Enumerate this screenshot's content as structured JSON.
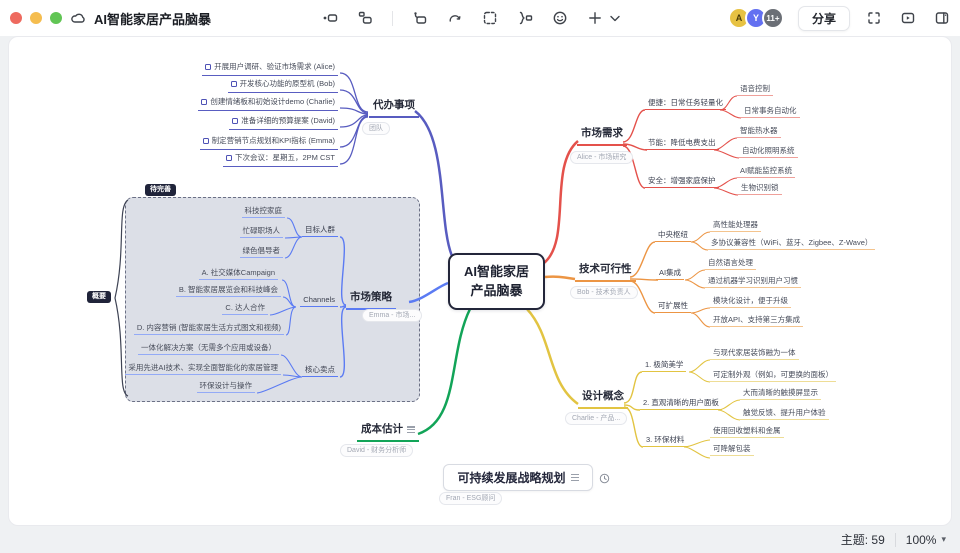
{
  "window": {
    "title": "AI智能家居产品脑暴",
    "toolbar": {
      "share_label": "分享",
      "avatars": [
        "A",
        "Y",
        "11+"
      ],
      "icon_names": [
        "cloud-icon",
        "topic-icon",
        "subtopic-icon",
        "relation-icon",
        "redo-icon",
        "marquee-select-icon",
        "summary-icon",
        "emoji-icon",
        "insert-icon",
        "chevron-down-icon",
        "fullscreen-icon",
        "present-icon",
        "side-panel-icon"
      ]
    }
  },
  "statusbar": {
    "topics": "主题: 59",
    "zoom": "100%"
  },
  "colors": {
    "todo": "#585cc0",
    "strategy": "#5b7bf3",
    "cost": "#12a458",
    "demand": "#e4514b",
    "tech": "#ec9544",
    "design": "#e2c442",
    "central_border": "#23263a"
  },
  "map": {
    "central": {
      "line1": "AI智能家居",
      "line2": "产品脑暴"
    },
    "todo": {
      "label": "代办事项",
      "tag": "团队",
      "items": [
        "开展用户调研、验证市场需求 (Alice)",
        "开发核心功能的原型机 (Bob)",
        "创建情绪板和初始设计demo (Charlie)",
        "准备详细的预算提案 (David)",
        "制定营销节点规划和KPI指标 (Emma)",
        "下次会议：星期五，2PM CST"
      ]
    },
    "strategy": {
      "label": "市场策略",
      "tag": "Emma - 市场...",
      "group_badge": "待完善",
      "summary_badge": "概要",
      "audience": {
        "label": "目标人群",
        "leaves": [
          "科技控家庭",
          "忙碌职场人",
          "绿色倡导者"
        ]
      },
      "channels": {
        "label": "Channels",
        "leaves": [
          "A. 社交媒体Campaign",
          "B. 智能家居展览会和科技峰会",
          "C. 达人合作",
          "D. 内容营销 (智能家居生活方式图文和视频)"
        ]
      },
      "selling": {
        "label": "核心卖点",
        "leaves": [
          "一体化解决方案（无需多个应用或设备）",
          "采用先进AI技术、实现全面智能化的家居管理",
          "环保设计与操作"
        ]
      }
    },
    "cost": {
      "label": "成本估计",
      "tag": "David - 财务分析师"
    },
    "demand": {
      "label": "市场需求",
      "tag": "Alice - 市场研究",
      "children": [
        {
          "label": "便捷：日常任务轻量化",
          "leaves": [
            "语音控制",
            "日常事务自动化"
          ]
        },
        {
          "label": "节能：降低电费支出",
          "leaves": [
            "智能热水器",
            "自动化照明系统"
          ]
        },
        {
          "label": "安全：增强家庭保护",
          "leaves": [
            "AI赋能监控系统",
            "生物识别锁"
          ]
        }
      ]
    },
    "tech": {
      "label": "技术可行性",
      "tag": "Bob - 技术负责人",
      "children": [
        {
          "label": "中央枢纽",
          "leaves": [
            "高性能处理器",
            "多协议兼容性（WiFi、蓝牙、Zigbee、Z-Wave）"
          ]
        },
        {
          "label": "AI集成",
          "leaves": [
            "自然语言处理",
            "通过机器学习识别用户习惯"
          ]
        },
        {
          "label": "可扩展性",
          "leaves": [
            "模块化设计，便于升级",
            "开放API、支持第三方集成"
          ]
        }
      ]
    },
    "design": {
      "label": "设计概念",
      "tag": "Charlie - 产品...",
      "children": [
        {
          "label": "1. 极简美学",
          "leaves": [
            "与现代家居装饰融为一体",
            "可定制外观（例如，可更换的面板）"
          ]
        },
        {
          "label": "2. 直观清晰的用户面板",
          "leaves": [
            "大而清晰的触摸屏显示",
            "触觉反馈、提升用户体验"
          ]
        },
        {
          "label": "3. 环保材料",
          "leaves": [
            "使用回收塑料和金属",
            "可降解包装"
          ]
        }
      ]
    },
    "sustain": {
      "label": "可持续发展战略规划",
      "tag": "Fran - ESG顾问"
    }
  }
}
